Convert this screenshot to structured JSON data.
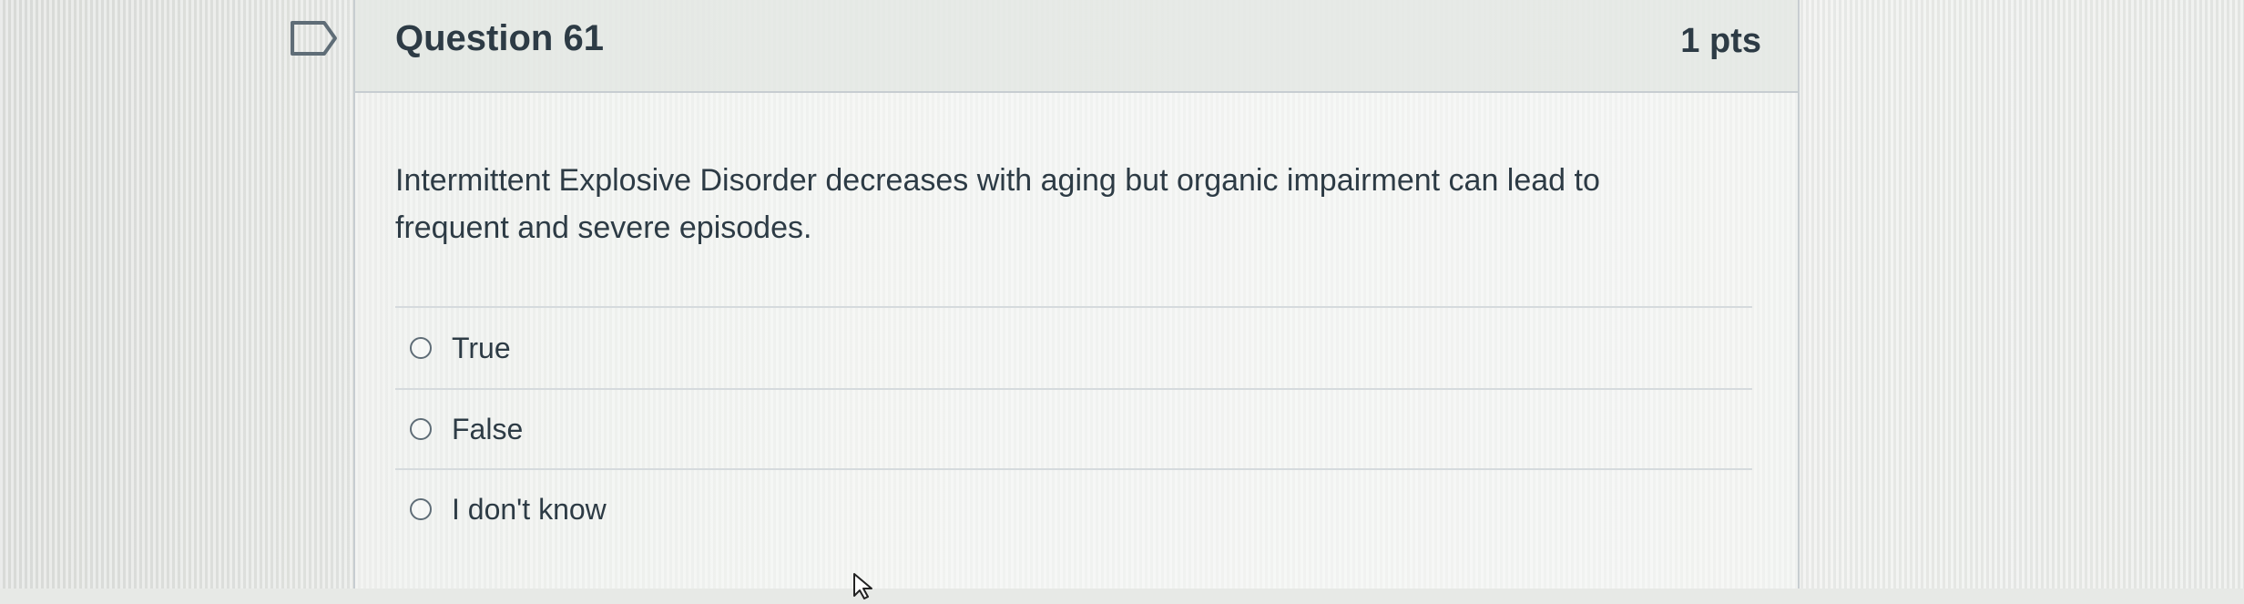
{
  "question": {
    "title": "Question 61",
    "points": "1 pts",
    "text": "Intermittent Explosive Disorder decreases with aging but organic impairment can lead to frequent and severe episodes."
  },
  "answers": [
    {
      "label": "True",
      "selected": false
    },
    {
      "label": "False",
      "selected": false
    },
    {
      "label": "I don't know",
      "selected": false
    }
  ],
  "icons": {
    "bookmark": "bookmark-flag-icon",
    "radio": "radio-button-icon",
    "cursor": "mouse-pointer-icon"
  },
  "colors": {
    "text": "#2d3b45",
    "border": "#c7cdd1"
  }
}
